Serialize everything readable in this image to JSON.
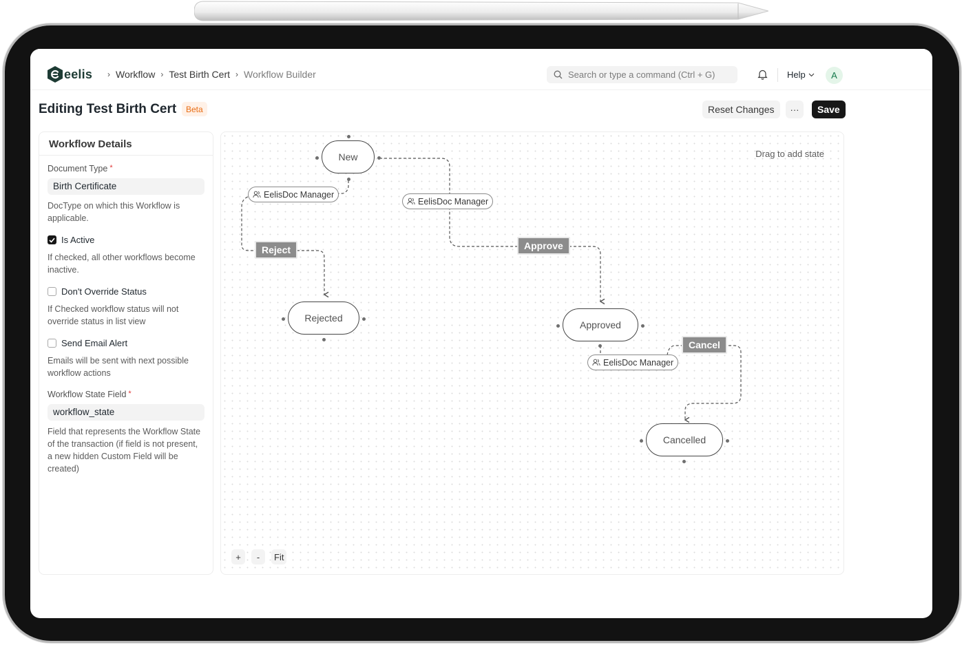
{
  "navbar": {
    "logo_text": "eelis",
    "breadcrumbs": [
      "Workflow",
      "Test Birth Cert",
      "Workflow Builder"
    ],
    "search_placeholder": "Search or type a command (Ctrl + G)",
    "help_label": "Help",
    "avatar_initial": "A"
  },
  "header": {
    "title": "Editing Test Birth Cert",
    "badge": "Beta",
    "reset_label": "Reset Changes",
    "more_label": "···",
    "save_label": "Save"
  },
  "details": {
    "title": "Workflow Details",
    "document_type": {
      "label": "Document Type",
      "required_mark": "*",
      "value": "Birth Certificate",
      "description": "DocType on which this Workflow is applicable."
    },
    "is_active": {
      "label": "Is Active",
      "checked": true,
      "description": "If checked, all other workflows become inactive."
    },
    "dont_override": {
      "label": "Don't Override Status",
      "checked": false,
      "description": "If Checked workflow status will not override status in list view"
    },
    "send_email": {
      "label": "Send Email Alert",
      "checked": false,
      "description": "Emails will be sent with next possible workflow actions"
    },
    "state_field": {
      "label": "Workflow State Field",
      "required_mark": "*",
      "value": "workflow_state",
      "description": "Field that represents the Workflow State of the transaction (if field is not present, a new hidden Custom Field will be created)"
    }
  },
  "canvas": {
    "hint": "Drag to add state",
    "zoom_in": "+",
    "zoom_out": "-",
    "fit": "Fit",
    "states": {
      "new": "New",
      "rejected": "Rejected",
      "approved": "Approved",
      "cancelled": "Cancelled"
    },
    "actions": {
      "reject": "Reject",
      "approve": "Approve",
      "cancel": "Cancel"
    },
    "roles": {
      "reject_role": "EelisDoc Manager",
      "approve_role": "EelisDoc Manager",
      "cancel_role": "EelisDoc Manager"
    }
  }
}
